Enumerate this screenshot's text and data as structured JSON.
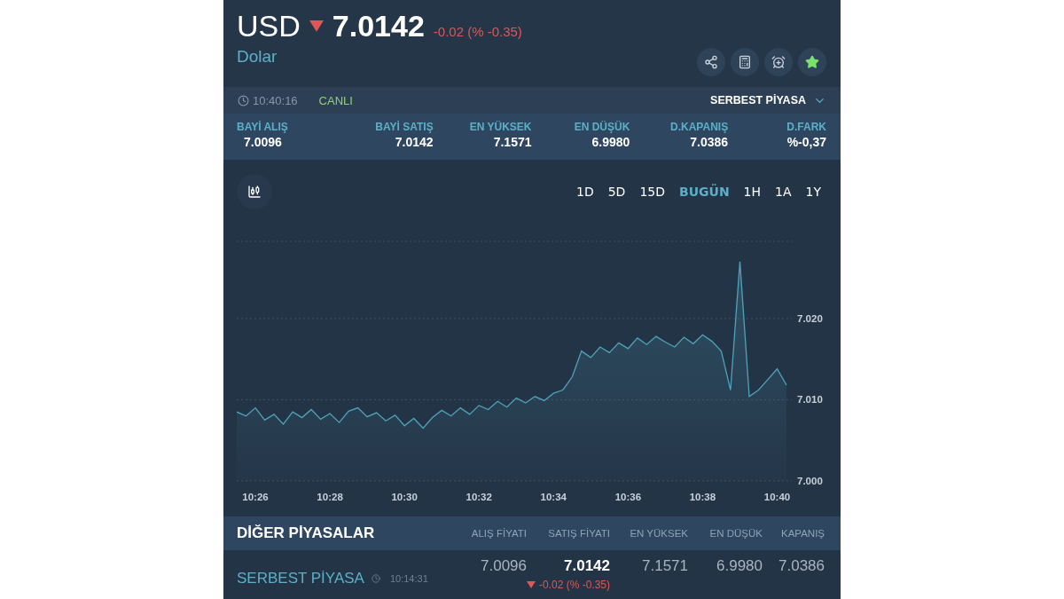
{
  "header": {
    "symbol": "USD",
    "down": true,
    "price": "7.0142",
    "change": "-0.02 (% -0.35)",
    "name": "Dolar"
  },
  "toolbar": [
    {
      "kind": "share"
    },
    {
      "kind": "calculator"
    },
    {
      "kind": "alarm"
    },
    {
      "kind": "favorite",
      "on": true
    }
  ],
  "status": {
    "time": "10:40:16",
    "live": "CANLI",
    "market": "SERBEST PİYASA"
  },
  "stats": [
    {
      "label": "BAYİ ALIŞ",
      "value": "7.0096"
    },
    {
      "label": "BAYİ SATIŞ",
      "value": "7.0142"
    },
    {
      "label": "EN YÜKSEK",
      "value": "7.1571"
    },
    {
      "label": "EN DÜŞÜK",
      "value": "6.9980"
    },
    {
      "label": "D.KAPANIŞ",
      "value": "7.0386"
    },
    {
      "label": "D.FARK",
      "value": "%-0,37"
    }
  ],
  "ranges": [
    {
      "label": "1D",
      "selected": false
    },
    {
      "label": "5D",
      "selected": false
    },
    {
      "label": "15D",
      "selected": false
    },
    {
      "label": "BUGÜN",
      "selected": true
    },
    {
      "label": "1H",
      "selected": false
    },
    {
      "label": "1A",
      "selected": false
    },
    {
      "label": "1Y",
      "selected": false
    }
  ],
  "chart_data": {
    "type": "area",
    "categories": [
      null,
      null,
      "10:26",
      null,
      null,
      null,
      null,
      null,
      null,
      null,
      "10:28",
      null,
      null,
      null,
      null,
      null,
      null,
      null,
      "10:30",
      null,
      null,
      null,
      null,
      null,
      null,
      null,
      "10:32",
      null,
      null,
      null,
      null,
      null,
      null,
      null,
      "10:34",
      null,
      null,
      null,
      null,
      null,
      null,
      null,
      "10:36",
      null,
      null,
      null,
      null,
      null,
      null,
      null,
      "10:38",
      null,
      null,
      null,
      null,
      null,
      null,
      null,
      "10:40",
      null
    ],
    "series": [
      {
        "color": "#4fa3b8",
        "values": [
          7.0085,
          7.008,
          7.009,
          7.0075,
          7.0082,
          7.007,
          7.0085,
          7.0078,
          7.0088,
          7.0076,
          7.0083,
          7.0072,
          7.0086,
          7.009,
          7.0079,
          7.0084,
          7.0074,
          7.0081,
          7.0068,
          7.0077,
          7.0065,
          7.0078,
          7.0087,
          7.008,
          7.009,
          7.0082,
          7.0093,
          7.0088,
          7.0098,
          7.0091,
          7.0102,
          7.0096,
          7.0104,
          7.0099,
          7.0108,
          7.0112,
          7.0128,
          7.016,
          7.0152,
          7.0165,
          7.0158,
          7.017,
          7.0163,
          7.0176,
          7.0168,
          7.0178,
          7.0171,
          7.0165,
          7.0177,
          7.0169,
          7.018,
          7.0172,
          7.016,
          7.0112,
          7.027,
          7.0104,
          7.0112,
          7.0125,
          7.0138,
          7.0118
        ]
      }
    ],
    "yticks": [
      {
        "value": 7.0,
        "label": "7.000"
      },
      {
        "value": 7.01,
        "label": "7.010"
      },
      {
        "value": 7.02,
        "label": "7.020"
      }
    ],
    "ylim": [
      7.0,
      7.0295
    ],
    "grid": true
  },
  "other_markets": {
    "title": "DİĞER PİYASALAR",
    "columns": [
      "ALIŞ FİYATI",
      "SATIŞ FİYATI",
      "EN YÜKSEK",
      "EN DÜŞÜK",
      "KAPANIŞ"
    ],
    "rows": [
      {
        "name": "SERBEST PİYASA",
        "time": "10:14:31",
        "buy": "7.0096",
        "sell": "7.0142",
        "down": true,
        "change": "-0.02 (% -0.35)",
        "high": "7.1571",
        "low": "6.9980",
        "close": "7.0386"
      }
    ]
  }
}
